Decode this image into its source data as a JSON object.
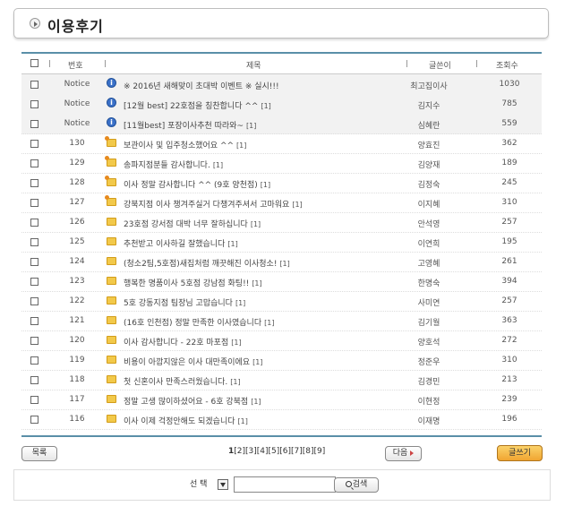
{
  "page": {
    "title": "이용후기"
  },
  "columns": {
    "no": "번호",
    "subject": "제목",
    "writer": "글쓴이",
    "views": "조회수"
  },
  "rows": [
    {
      "no": "Notice",
      "icon": "info-icon",
      "subject": "※ 2016년 새해맞이 초대박 이벤트 ※ 실시!!!",
      "count": "",
      "writer": "최고집이사",
      "views": "1030"
    },
    {
      "no": "Notice",
      "icon": "info-icon",
      "subject": "[12월 best] 22호점을 칭찬합니다 ^^",
      "count": "[1]",
      "writer": "김지수",
      "views": "785"
    },
    {
      "no": "Notice",
      "icon": "info-icon",
      "subject": "[11월best] 포장이사추천 따라와~",
      "count": "[1]",
      "writer": "심혜란",
      "views": "559"
    },
    {
      "no": "130",
      "icon": "new-folder-icon",
      "subject": "보관이사 및 입주청소했어요 ^^",
      "count": "[1]",
      "writer": "양효진",
      "views": "362"
    },
    {
      "no": "129",
      "icon": "new-folder-icon",
      "subject": "송파지점분들 감사합니다.",
      "count": "[1]",
      "writer": "김양재",
      "views": "189"
    },
    {
      "no": "128",
      "icon": "new-folder-icon",
      "subject": "이사 정말 감사합니다 ^^ (9호 양천점)",
      "count": "[1]",
      "writer": "김정숙",
      "views": "245"
    },
    {
      "no": "127",
      "icon": "new-folder-icon",
      "subject": "강북지점 이사 챙겨주실거 다챙겨주셔서 고마워요",
      "count": "[1]",
      "writer": "이지혜",
      "views": "310"
    },
    {
      "no": "126",
      "icon": "folder-icon",
      "subject": "23호점 강서점 대박 너무 잘하십니다",
      "count": "[1]",
      "writer": "안석영",
      "views": "257"
    },
    {
      "no": "125",
      "icon": "folder-icon",
      "subject": "추천받고 이사하길 잘했습니다",
      "count": "[1]",
      "writer": "이연희",
      "views": "195"
    },
    {
      "no": "124",
      "icon": "folder-icon",
      "subject": "(청소2팀,5호점)새집처럼 깨끗해진 이사청소!",
      "count": "[1]",
      "writer": "고영혜",
      "views": "261"
    },
    {
      "no": "123",
      "icon": "folder-icon",
      "subject": "행복한 명품이사 5호점 강남점 화팅!!",
      "count": "[1]",
      "writer": "한명숙",
      "views": "394"
    },
    {
      "no": "122",
      "icon": "folder-icon",
      "subject": "5호 강동지점 팀장님 고맙습니다",
      "count": "[1]",
      "writer": "사미연",
      "views": "257"
    },
    {
      "no": "121",
      "icon": "folder-icon",
      "subject": "(16호 인천점) 정말 만족한 이사였습니다",
      "count": "[1]",
      "writer": "김기월",
      "views": "363"
    },
    {
      "no": "120",
      "icon": "folder-icon",
      "subject": "이사 감사합니다 - 22호 마포점",
      "count": "[1]",
      "writer": "양호석",
      "views": "272"
    },
    {
      "no": "119",
      "icon": "folder-icon",
      "subject": "비용이 아깝지않은 이사 대만족이에요",
      "count": "[1]",
      "writer": "정준우",
      "views": "310"
    },
    {
      "no": "118",
      "icon": "folder-icon",
      "subject": "첫 신혼이사 만족스러웠습니다.",
      "count": "[1]",
      "writer": "김경민",
      "views": "213"
    },
    {
      "no": "117",
      "icon": "folder-icon",
      "subject": "정말 고생 많이하셨어요 - 6호 강북점",
      "count": "[1]",
      "writer": "이현정",
      "views": "239"
    },
    {
      "no": "116",
      "icon": "folder-icon",
      "subject": "이사 이제 걱정안해도 되겠습니다",
      "count": "[1]",
      "writer": "이재명",
      "views": "196"
    }
  ],
  "buttons": {
    "list": "목록",
    "next": "다음",
    "write": "글쓰기",
    "search": "검색"
  },
  "pagination": {
    "current": "1",
    "pages": [
      "[2]",
      "[3]",
      "[4]",
      "[5]",
      "[6]",
      "[7]",
      "[8]",
      "[9]"
    ]
  },
  "search": {
    "select_label": "선 택",
    "value": ""
  }
}
